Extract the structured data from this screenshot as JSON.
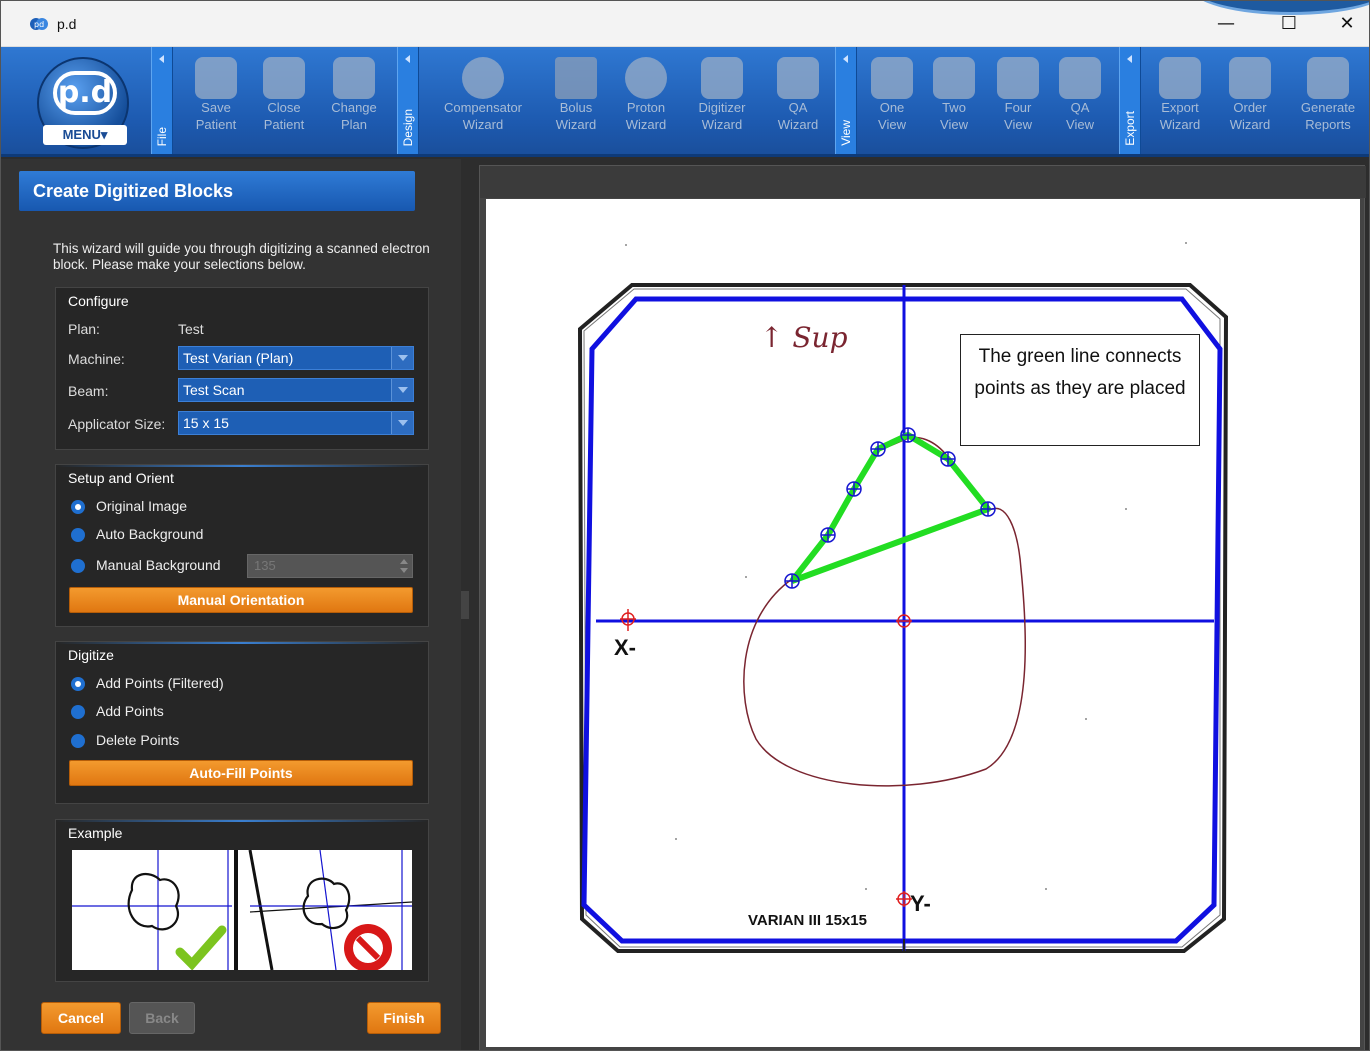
{
  "window": {
    "title": "p.d",
    "minimize": "—",
    "maximize": "☐",
    "close": "✕"
  },
  "ribbon": {
    "menu": {
      "logo_text": "p.d",
      "label": "MENU▾"
    },
    "groups": [
      {
        "label": "File",
        "items": [
          {
            "label": "Save\nPatient",
            "line1": "Save",
            "line2": "Patient",
            "icon": "save-patient-icon"
          },
          {
            "line1": "Close",
            "line2": "Patient",
            "icon": "close-patient-icon"
          },
          {
            "line1": "Change",
            "line2": "Plan",
            "icon": "change-plan-icon"
          }
        ]
      },
      {
        "label": "Design",
        "items": [
          {
            "line1": "Compensator",
            "line2": "Wizard",
            "icon": "compensator-icon"
          },
          {
            "line1": "Bolus",
            "line2": "Wizard",
            "icon": "bolus-icon"
          },
          {
            "line1": "Proton",
            "line2": "Wizard",
            "icon": "proton-icon"
          },
          {
            "line1": "Digitizer",
            "line2": "Wizard",
            "icon": "digitizer-icon"
          },
          {
            "line1": "QA",
            "line2": "Wizard",
            "icon": "qa-wizard-icon"
          }
        ]
      },
      {
        "label": "View",
        "items": [
          {
            "line1": "One",
            "line2": "View",
            "icon": "one-view-icon"
          },
          {
            "line1": "Two",
            "line2": "View",
            "icon": "two-view-icon"
          },
          {
            "line1": "Four",
            "line2": "View",
            "icon": "four-view-icon"
          },
          {
            "line1": "QA",
            "line2": "View",
            "icon": "qa-view-icon"
          }
        ]
      },
      {
        "label": "Export",
        "items": [
          {
            "line1": "Export",
            "line2": "Wizard",
            "icon": "export-icon"
          },
          {
            "line1": "Order",
            "line2": "Wizard",
            "icon": "order-icon"
          },
          {
            "line1": "Generate",
            "line2": "Reports",
            "icon": "reports-icon"
          }
        ]
      }
    ]
  },
  "panel": {
    "title": "Create Digitized Blocks",
    "intro": "This wizard will guide you through digitizing a scanned electron block. Please make your selections below.",
    "configure": {
      "title": "Configure",
      "plan_label": "Plan:",
      "plan_value": "Test",
      "machine_label": "Machine:",
      "machine_value": "Test Varian (Plan)",
      "beam_label": "Beam:",
      "beam_value": "Test Scan",
      "applicator_label": "Applicator Size:",
      "applicator_value": "15 x 15"
    },
    "setup": {
      "title": "Setup and Orient",
      "opt1": "Original Image",
      "opt2": "Auto Background",
      "opt3": "Manual Background",
      "selected": "Original Image",
      "manual_value": "135",
      "button": "Manual Orientation"
    },
    "digitize": {
      "title": "Digitize",
      "opt1": "Add Points (Filtered)",
      "opt2": "Add Points",
      "opt3": "Delete Points",
      "selected": "Add Points (Filtered)",
      "button": "Auto-Fill Points"
    },
    "example": {
      "title": "Example"
    },
    "buttons": {
      "cancel": "Cancel",
      "back": "Back",
      "finish": "Finish"
    }
  },
  "image": {
    "sup_label": "↑ Sup",
    "x_label": "X-",
    "y_label": "Y-",
    "block_label": "VARIAN III 15x15",
    "callout": "The green line connects points as they are placed",
    "colors": {
      "field": "#1010e0",
      "points": "#22dd22",
      "contour": "#7a2530",
      "marker": "#e02020"
    }
  }
}
